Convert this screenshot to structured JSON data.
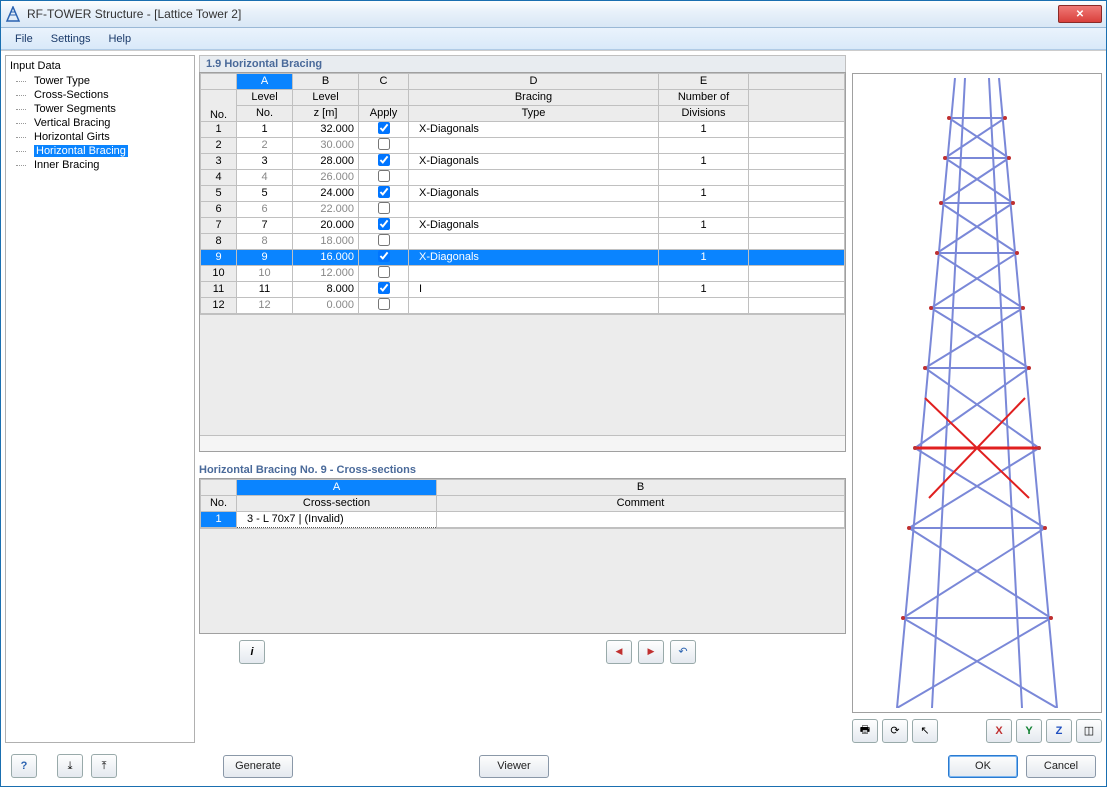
{
  "window": {
    "title": "RF-TOWER Structure - [Lattice Tower 2]"
  },
  "menu": {
    "file": "File",
    "settings": "Settings",
    "help": "Help"
  },
  "sidebar": {
    "title": "Input Data",
    "items": [
      {
        "label": "Tower Type"
      },
      {
        "label": "Cross-Sections"
      },
      {
        "label": "Tower Segments"
      },
      {
        "label": "Vertical Bracing"
      },
      {
        "label": "Horizontal Girts"
      },
      {
        "label": "Horizontal Bracing",
        "selected": true
      },
      {
        "label": "Inner Bracing"
      }
    ]
  },
  "panel": {
    "title": "1.9 Horizontal Bracing",
    "col_letters": [
      "A",
      "B",
      "C",
      "D",
      "E"
    ],
    "col_headers": {
      "no": "No.",
      "a1": "Level",
      "a2": "No.",
      "b1": "Level",
      "b2": "z [m]",
      "c2": "Apply",
      "d1": "Bracing",
      "d2": "Type",
      "e1": "Number of",
      "e2": "Divisions"
    },
    "rows": [
      {
        "n": "1",
        "lvl": "1",
        "z": "32.000",
        "apply": true,
        "type": "X-Diagonals",
        "div": "1"
      },
      {
        "n": "2",
        "lvl": "2",
        "z": "30.000",
        "apply": false,
        "type": "",
        "div": ""
      },
      {
        "n": "3",
        "lvl": "3",
        "z": "28.000",
        "apply": true,
        "type": "X-Diagonals",
        "div": "1"
      },
      {
        "n": "4",
        "lvl": "4",
        "z": "26.000",
        "apply": false,
        "type": "",
        "div": ""
      },
      {
        "n": "5",
        "lvl": "5",
        "z": "24.000",
        "apply": true,
        "type": "X-Diagonals",
        "div": "1"
      },
      {
        "n": "6",
        "lvl": "6",
        "z": "22.000",
        "apply": false,
        "type": "",
        "div": ""
      },
      {
        "n": "7",
        "lvl": "7",
        "z": "20.000",
        "apply": true,
        "type": "X-Diagonals",
        "div": "1"
      },
      {
        "n": "8",
        "lvl": "8",
        "z": "18.000",
        "apply": false,
        "type": "",
        "div": ""
      },
      {
        "n": "9",
        "lvl": "9",
        "z": "16.000",
        "apply": true,
        "type": "X-Diagonals",
        "div": "1",
        "selected": true
      },
      {
        "n": "10",
        "lvl": "10",
        "z": "12.000",
        "apply": false,
        "type": "",
        "div": ""
      },
      {
        "n": "11",
        "lvl": "11",
        "z": "8.000",
        "apply": true,
        "type": "I",
        "div": "1"
      },
      {
        "n": "12",
        "lvl": "12",
        "z": "0.000",
        "apply": false,
        "type": "",
        "div": ""
      }
    ]
  },
  "subpanel": {
    "title": "Horizontal Bracing No. 9  -  Cross-sections",
    "col_letters": [
      "A",
      "B"
    ],
    "col_headers": {
      "no": "No.",
      "a": "Cross-section",
      "b": "Comment"
    },
    "rows": [
      {
        "n": "1",
        "xs": "3 - L 70x7 | (Invalid)",
        "c": ""
      }
    ]
  },
  "buttons": {
    "generate": "Generate",
    "viewer": "Viewer",
    "ok": "OK",
    "cancel": "Cancel"
  },
  "icon_buttons": {
    "info": "info-icon",
    "prev": "◀",
    "next": "▶",
    "undo": "↶",
    "help": "?"
  },
  "axis_buttons": {
    "x": "X",
    "y": "Y",
    "z": "Z"
  }
}
